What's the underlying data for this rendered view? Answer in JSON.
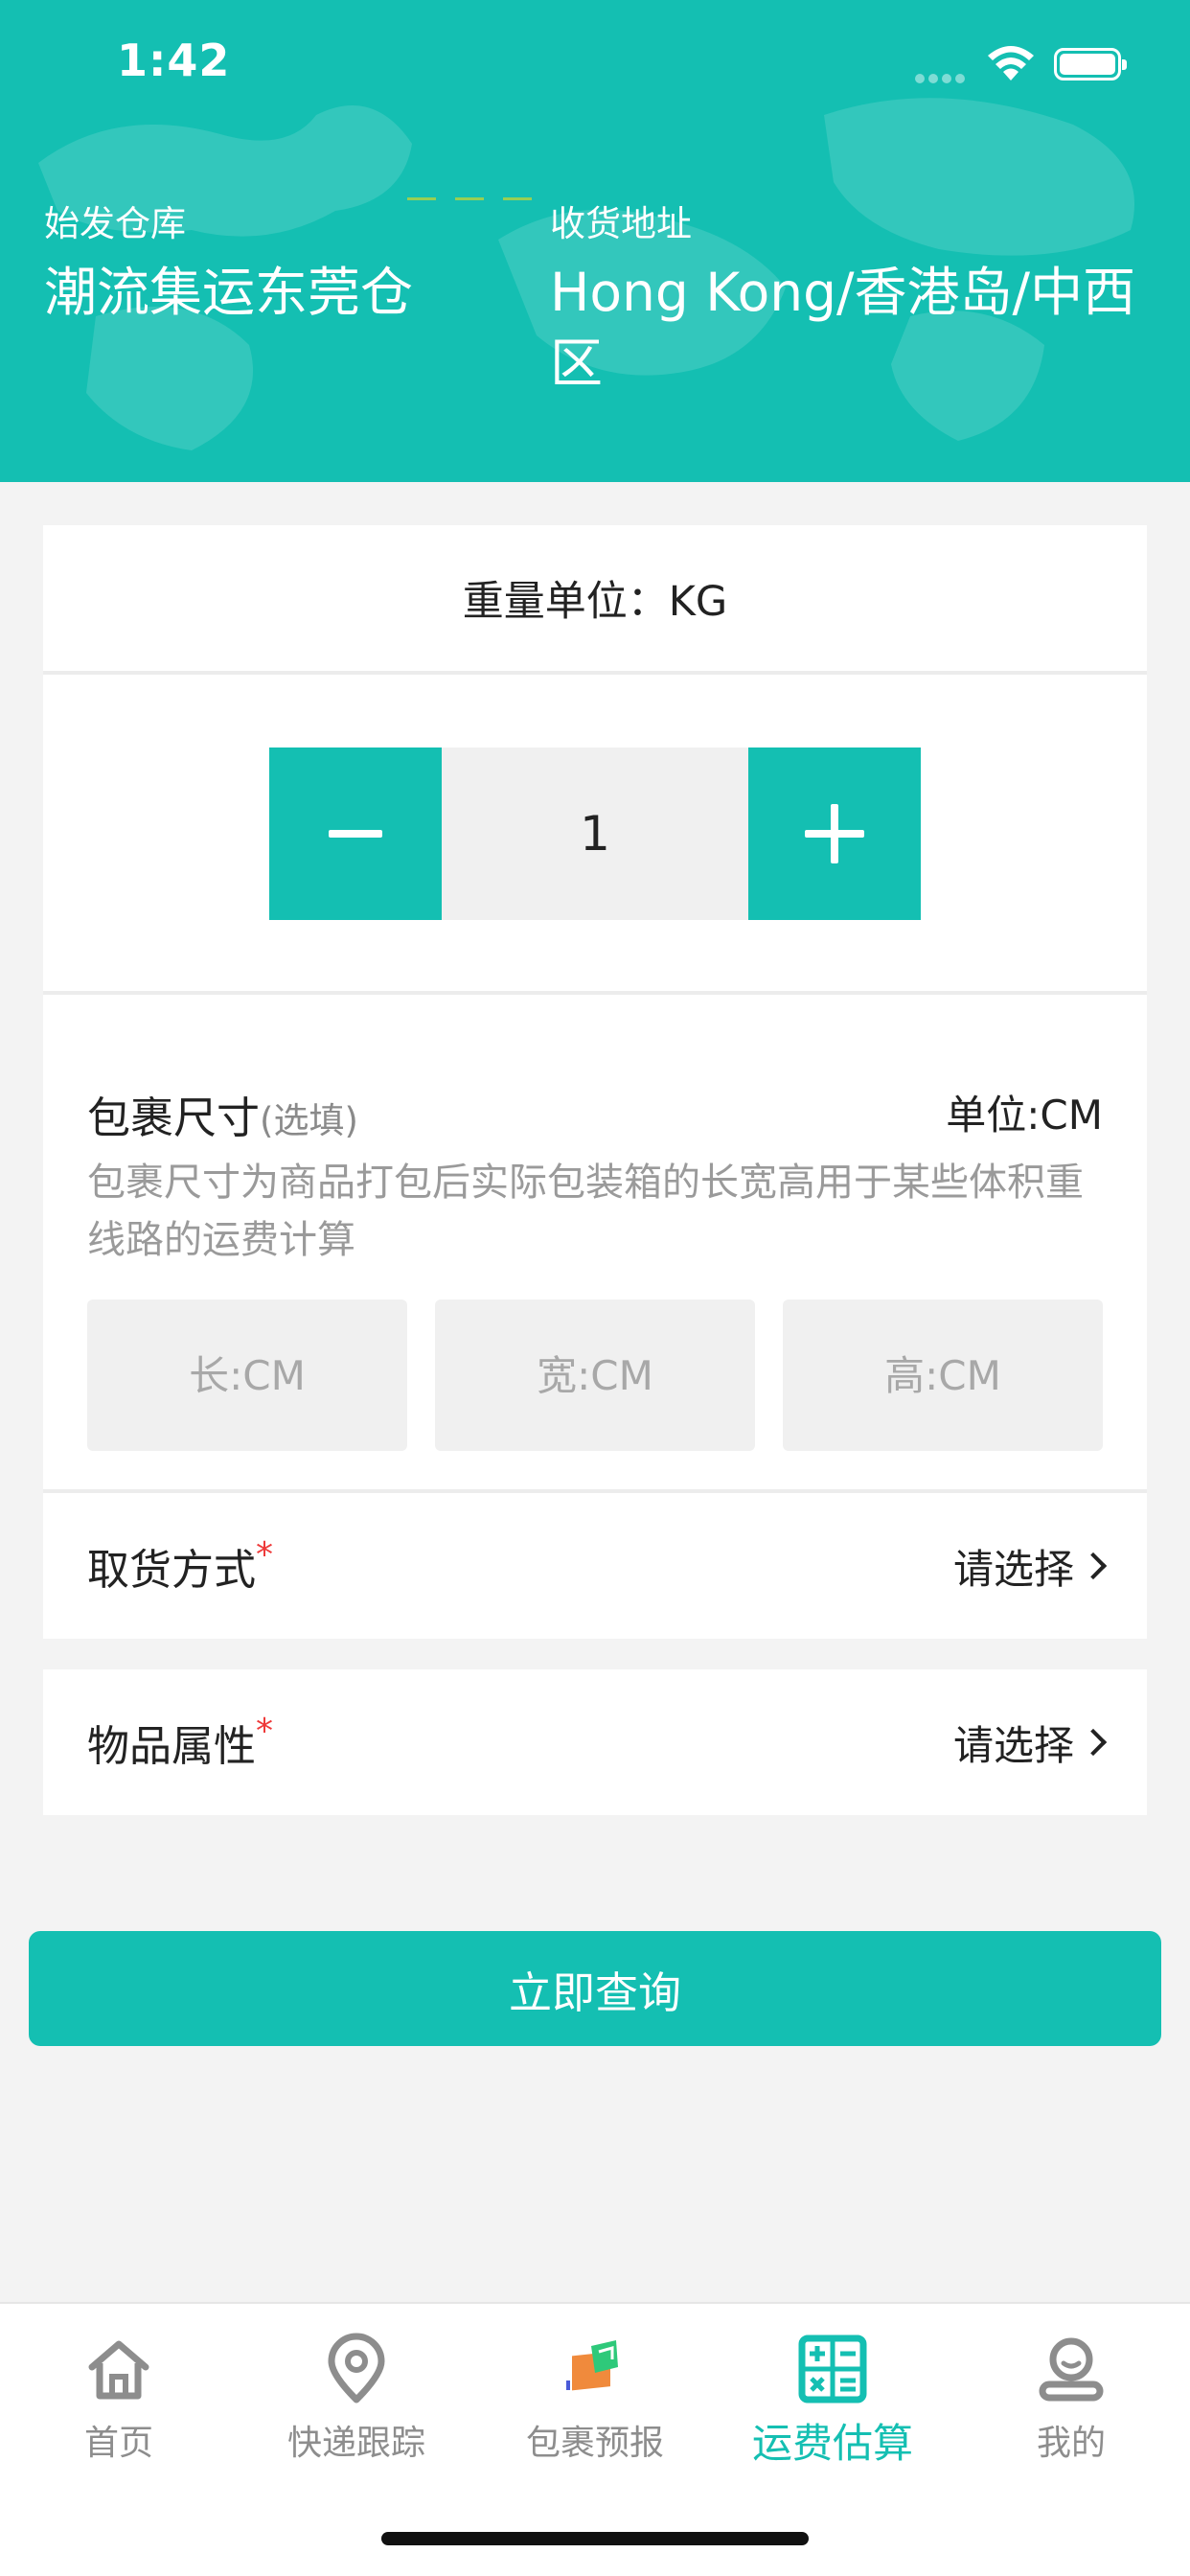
{
  "status_bar": {
    "time": "1:42"
  },
  "header": {
    "origin_label": "始发仓库",
    "origin_value": "潮流集运东莞仓",
    "dest_label": "收货地址",
    "dest_value": "Hong Kong/香港岛/中西区",
    "bg_color": "#14bfb2"
  },
  "weight": {
    "unit_label": "重量单位：KG",
    "quantity": "1"
  },
  "size": {
    "title": "包裹尺寸",
    "optional": "(选填)",
    "unit": "单位:CM",
    "description": "包裹尺寸为商品打包后实际包装箱的长宽高用于某些体积重线路的运费计算",
    "length_placeholder": "长:CM",
    "width_placeholder": "宽:CM",
    "height_placeholder": "高:CM"
  },
  "pickup": {
    "label": "取货方式",
    "required_mark": "*",
    "value": "请选择"
  },
  "attribute": {
    "label": "物品属性",
    "required_mark": "*",
    "value": "请选择"
  },
  "query_button": "立即查询",
  "tabbar": {
    "items": [
      {
        "label": "首页",
        "icon": "home-icon"
      },
      {
        "label": "快递跟踪",
        "icon": "location-pin-icon"
      },
      {
        "label": "包裹预报",
        "icon": "package-forecast-icon"
      },
      {
        "label": "运费估算",
        "icon": "calculator-icon",
        "active": true
      },
      {
        "label": "我的",
        "icon": "user-icon"
      }
    ]
  },
  "colors": {
    "accent": "#14bfb2",
    "required": "#ee3a3a"
  }
}
